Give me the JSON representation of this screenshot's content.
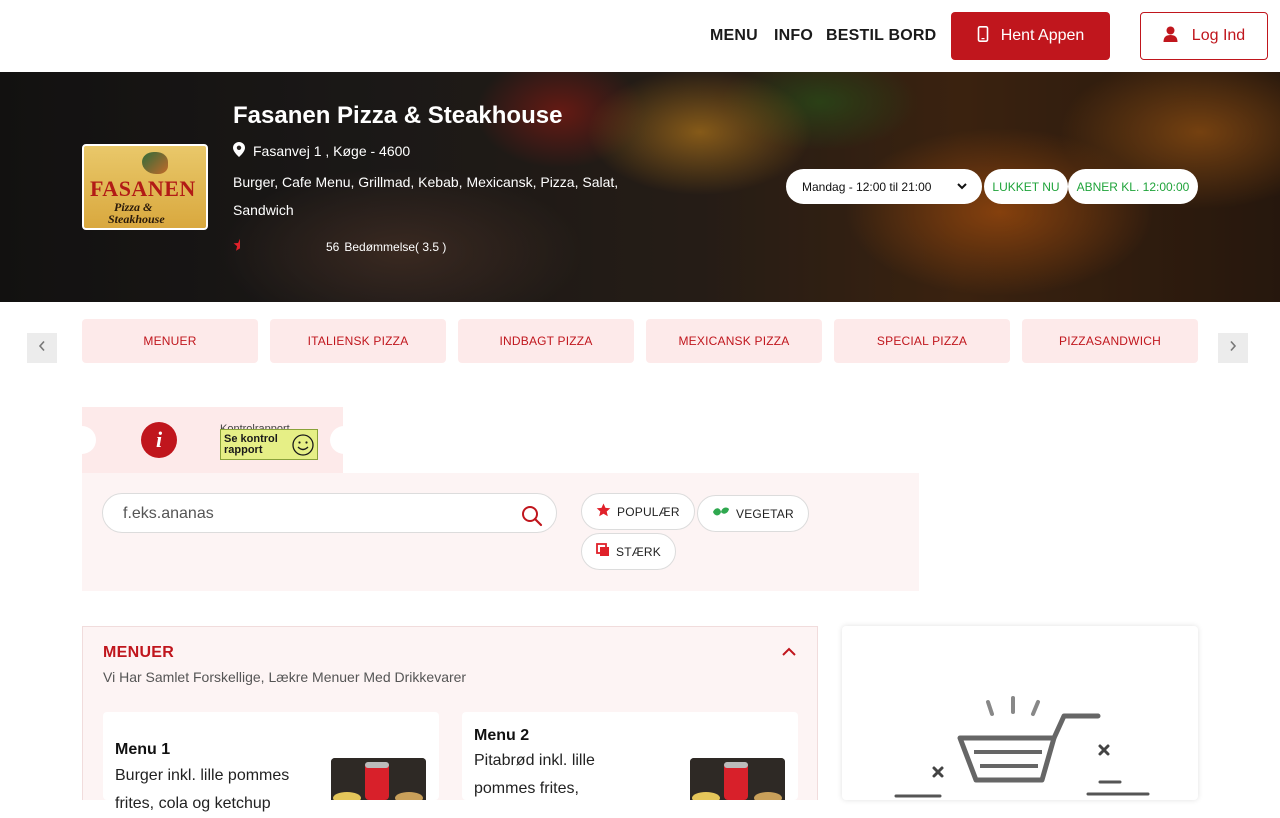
{
  "header": {
    "nav": [
      {
        "label": "MENU"
      },
      {
        "label": "INFO"
      },
      {
        "label": "BESTIL BORD"
      }
    ],
    "app_button": "Hent Appen",
    "login_button": "Log Ind"
  },
  "restaurant": {
    "name": "Fasanen Pizza & Steakhouse",
    "address": "Fasanvej 1 , Køge - 4600",
    "cuisines": "Burger, Cafe Menu, Grillmad, Kebab, Mexicansk, Pizza, Salat, Sandwich",
    "review_count": "56",
    "rating_label": "Bedømmelse( 3.5 )",
    "rating": 3.5,
    "logo": {
      "line1": "FASANEN",
      "line2": "Pizza &",
      "line3": "Steakhouse"
    }
  },
  "hours": {
    "selected": "Mandag - 12:00 til 21:00",
    "status": "LUKKET NU",
    "opens": "ABNER KL. 12:00:00"
  },
  "categories": [
    {
      "label": "MENUER"
    },
    {
      "label": "ITALIENSK PIZZA"
    },
    {
      "label": "INDBAGT PIZZA"
    },
    {
      "label": "MEXICANSK PIZZA"
    },
    {
      "label": "SPECIAL PIZZA"
    },
    {
      "label": "PIZZASANDWICH"
    }
  ],
  "info": {
    "kontrol_label": "Kontrolrapport",
    "badge_line1": "Se kontrol",
    "badge_line2": "rapport"
  },
  "search": {
    "placeholder": "f.eks.ananas"
  },
  "filters": [
    {
      "label": "POPULÆR"
    },
    {
      "label": "VEGETAR"
    },
    {
      "label": "STÆRK"
    }
  ],
  "menu_section": {
    "title": "MENUER",
    "description": "Vi Har Samlet Forskellige, Lækre Menuer Med Drikkevarer",
    "items": [
      {
        "name": "Menu 1",
        "desc_line1": "Burger inkl. lille pommes",
        "desc_line2": "frites, cola og ketchup"
      },
      {
        "name": "Menu 2",
        "desc_line1": "Pitabrød inkl. lille",
        "desc_line2": "pommes frites,"
      }
    ]
  },
  "colors": {
    "brand": "#c0161d",
    "open_status": "#1fa33a",
    "tint": "#fdeaea"
  }
}
